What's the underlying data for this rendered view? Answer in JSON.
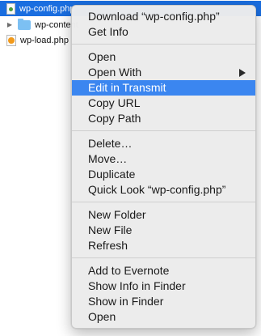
{
  "files": [
    {
      "name": "wp-config.php"
    },
    {
      "name": "wp-content"
    },
    {
      "name": "wp-load.php"
    }
  ],
  "menu": {
    "groups": [
      [
        "Download “wp-config.php”",
        "Get Info"
      ],
      [
        "Open",
        "Open With",
        "Edit in Transmit",
        "Copy URL",
        "Copy Path"
      ],
      [
        "Delete…",
        "Move…",
        "Duplicate",
        "Quick Look “wp-config.php”"
      ],
      [
        "New Folder",
        "New File",
        "Refresh"
      ],
      [
        "Add to Evernote",
        "Show Info in Finder",
        "Show in Finder",
        "Open"
      ]
    ],
    "highlighted": "Edit in Transmit",
    "submenu_item": "Open With"
  },
  "colors": {
    "selection": "#1a6ee0",
    "menu_highlight": "#3b86f0"
  }
}
